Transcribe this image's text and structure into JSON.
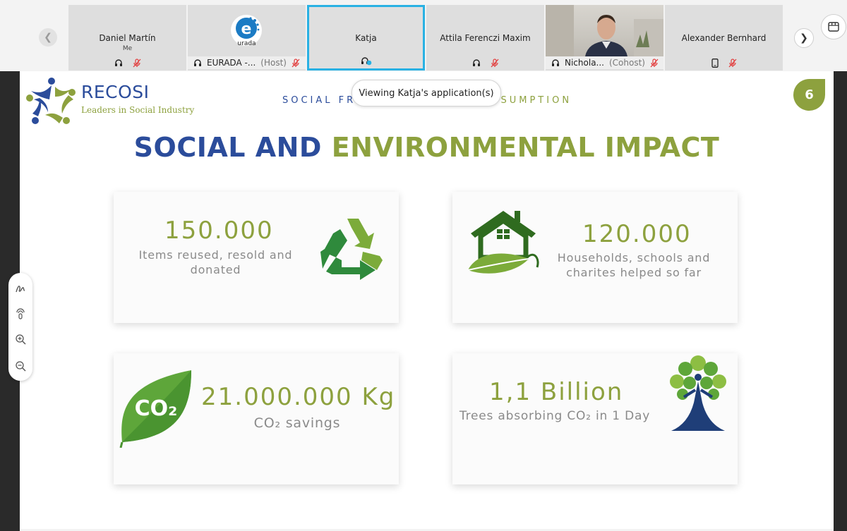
{
  "meeting": {
    "participants": [
      {
        "name": "Daniel Martín",
        "sub": "Me"
      },
      {
        "name": "EURADA -...",
        "role": "(Host)",
        "logo_text": "urada"
      },
      {
        "name": "Katja"
      },
      {
        "name": "Attila Ferenczi Maxim"
      },
      {
        "name": "Nichola...",
        "role": "(Cohost)"
      },
      {
        "name": "Alexander Bernhard"
      }
    ],
    "toast": "Viewing Katja's application(s)"
  },
  "slide": {
    "brand": {
      "name": "RECOSI",
      "tagline": "Leaders in Social Industry"
    },
    "header_left": "SOCIAL FRA",
    "header_right": "IT CONSUMPTION",
    "page_number": "6",
    "title_part1": "SOCIAL AND",
    "title_part2": "ENVIRONMENTAL IMPACT",
    "cards": [
      {
        "value": "150.000",
        "line1": "Items reused, resold and",
        "line2": "donated",
        "icon": "recycle-icon"
      },
      {
        "value": "120.000",
        "line1": "Households, schools and",
        "line2": "charites helped so far",
        "icon": "eco-house-icon"
      },
      {
        "value": "21.000.000 Kg",
        "line1": "CO₂ savings",
        "icon": "co2-leaf-icon",
        "leaf_text": "CO₂"
      },
      {
        "value": "1,1 Billion",
        "line1": "Trees absorbing CO₂ in 1 Day",
        "icon": "tree-people-icon"
      }
    ]
  },
  "colors": {
    "brand_blue": "#2b4c9b",
    "brand_green": "#8da13e",
    "active_tile": "#29b1e3",
    "mic_off": "#e23b3b"
  },
  "toolbar_icons": [
    "annotate-pen-icon",
    "pointer-icon",
    "zoom-in-icon",
    "zoom-out-icon"
  ]
}
